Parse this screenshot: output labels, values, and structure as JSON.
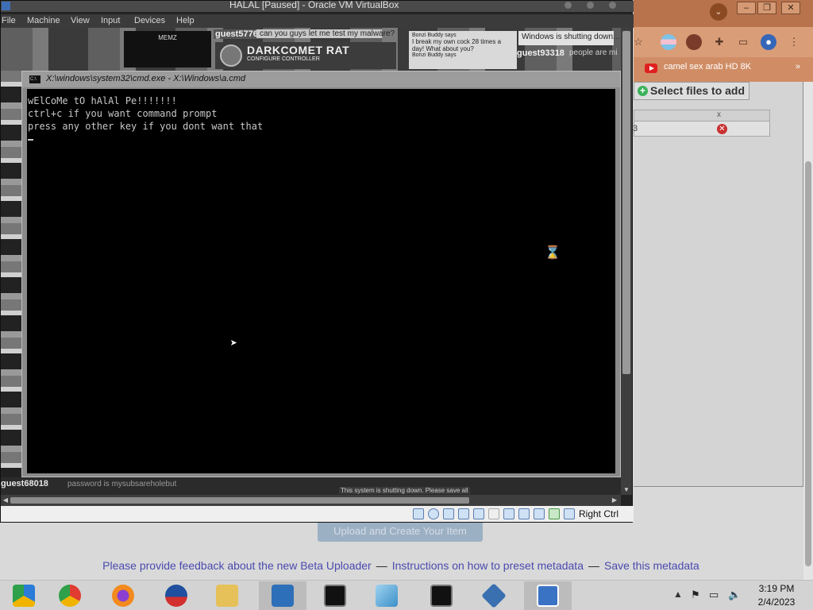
{
  "host_browser": {
    "tab_search_icon": "chevron-down-icon",
    "bookmark": "camel sex arab HD 8K",
    "bookmark_more": "»",
    "select_files_label": "Select files to add",
    "files_table": {
      "col_x": "x",
      "row_value": "3"
    },
    "upload_label": "Upload and Create Your Item",
    "footer_links": [
      "Please provide feedback about the new Beta Uploader",
      "Instructions on how to preset metadata",
      "Save this metadata"
    ],
    "footer_separator": "—"
  },
  "vbox": {
    "title": "HALAL [Paused] - Oracle VM VirtualBox",
    "menu": [
      "File",
      "Machine",
      "View",
      "Input",
      "Devices",
      "Help"
    ],
    "host_key": "Right Ctrl"
  },
  "guest": {
    "memz": "MEMZ",
    "user1": "guest57769",
    "msg1": "can you guys let me test my malware?",
    "darkcomet_title": "DARKCOMET RAT",
    "darkcomet_sub": "CONFIGURE CONTROLLER",
    "chat2_header": "Bonzi Buddy says",
    "chat2_msg": "I break my own cock 28 times a day! What about you?",
    "chat2_footer": "Bonzi Buddy says",
    "shutdown_msg": "Windows is shutting down...",
    "user2": "guest93318",
    "msg3": "people are mi",
    "user_bottom": "guest68018",
    "msg_bottom": "password is mysubsareholebut",
    "shutdown_strip": "This system is shutting down. Please save all"
  },
  "cmd": {
    "title": "X:\\windows\\system32\\cmd.exe - X:\\Windows\\a.cmd",
    "lines": [
      "wElCoMe tO hAlAl Pe!!!!!!!",
      "ctrl+c if you want command prompt",
      "press any other key if you dont want that"
    ]
  },
  "taskbar": {
    "apps": [
      "chrome-dev",
      "chrome",
      "firefox",
      "obama-logo",
      "file-explorer",
      "settings-window",
      "cmd",
      "notepad",
      "cmd",
      "virtualbox",
      "win10-vm"
    ],
    "time": "3:19 PM",
    "date": "2/4/2023"
  }
}
